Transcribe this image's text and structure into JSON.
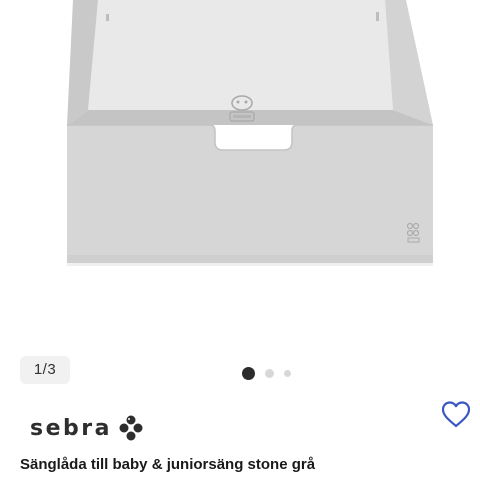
{
  "gallery": {
    "counter": "1/3",
    "dots": [
      "active",
      "inactive",
      "inactive"
    ]
  },
  "product": {
    "brand": "sebra",
    "title": "Sänglåda till baby & juniorsäng stone grå"
  },
  "icons": {
    "favorite": "heart-outline-icon",
    "brand_logo": "sebra-logo-mark"
  },
  "colors": {
    "drawer": "#d5d5d5",
    "accent_heart": "#3a57c4",
    "text": "#1a1a1a"
  }
}
